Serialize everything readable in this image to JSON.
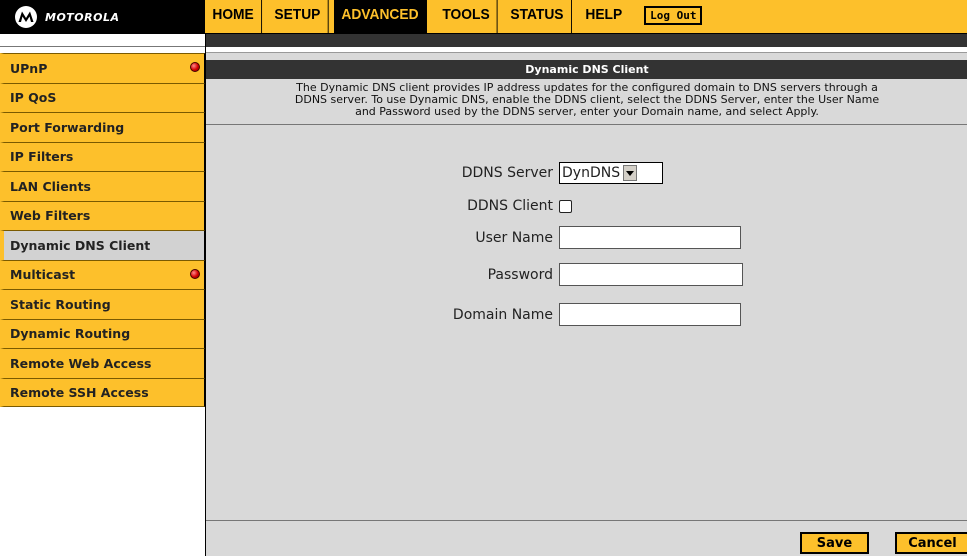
{
  "brand": {
    "name": "MOTOROLA",
    "logo_icon": "motorola-batwing-logo"
  },
  "nav": {
    "items": [
      {
        "label": "HOME",
        "active": false
      },
      {
        "label": "SETUP",
        "active": false
      },
      {
        "label": "ADVANCED",
        "active": true
      },
      {
        "label": "TOOLS",
        "active": false
      },
      {
        "label": "STATUS",
        "active": false
      },
      {
        "label": "HELP",
        "active": false
      }
    ],
    "logout_label": "Log Out"
  },
  "sidebar": {
    "items": [
      {
        "label": "UPnP",
        "alert_icon": true
      },
      {
        "label": "IP QoS",
        "alert_icon": false
      },
      {
        "label": "Port Forwarding",
        "alert_icon": false
      },
      {
        "label": "IP Filters",
        "alert_icon": false
      },
      {
        "label": "LAN Clients",
        "alert_icon": false
      },
      {
        "label": "Web Filters",
        "alert_icon": false
      },
      {
        "label": "Dynamic DNS Client",
        "alert_icon": false,
        "selected": true
      },
      {
        "label": "Multicast",
        "alert_icon": true
      },
      {
        "label": "Static Routing",
        "alert_icon": false
      },
      {
        "label": "Dynamic Routing",
        "alert_icon": false
      },
      {
        "label": "Remote Web Access",
        "alert_icon": false
      },
      {
        "label": "Remote SSH Access",
        "alert_icon": false
      }
    ]
  },
  "page": {
    "title": "Dynamic DNS Client",
    "description_lines": [
      "The Dynamic DNS client provides IP address updates for the configured domain to DNS servers through a",
      "DDNS server. To use Dynamic DNS, enable the DDNS client, select the DDNS Server, enter the User Name",
      "and Password used by the DDNS server, enter your Domain name, and select Apply."
    ]
  },
  "form": {
    "ddns_server_label": "DDNS Server",
    "ddns_server_value": "DynDNS",
    "ddns_client_label": "DDNS Client",
    "ddns_client_checked": false,
    "user_name_label": "User Name",
    "user_name_value": "",
    "password_label": "Password",
    "password_value": "",
    "domain_name_label": "Domain Name",
    "domain_name_value": ""
  },
  "actions": {
    "save_label": "Save",
    "cancel_label": "Cancel"
  },
  "colors": {
    "accent": "#fdc02b",
    "header_dark": "#000000",
    "panel_bg": "#d9d9d9",
    "alert_red": "#d40000"
  }
}
